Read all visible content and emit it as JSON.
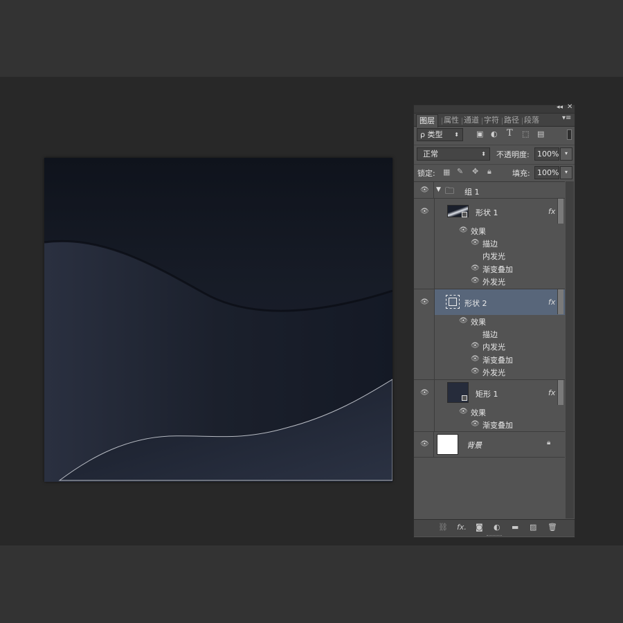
{
  "colors": {
    "canvas_top": "#141822",
    "canvas_mid": "#1a1f2b",
    "canvas_wave": "#262b39",
    "selected_row": "#58667a",
    "panel_bg": "#535353"
  },
  "panel": {
    "tabs": [
      "图层",
      "属性",
      "通道",
      "字符",
      "路径",
      "段落"
    ],
    "filter": {
      "label": "ρ 类型"
    },
    "blend_mode": "正常",
    "opacity": {
      "label": "不透明度:",
      "value": "100%"
    },
    "lock": {
      "label": "锁定:"
    },
    "fill": {
      "label": "填充:",
      "value": "100%"
    },
    "fx_label": "fx"
  },
  "layers": {
    "group": {
      "name": "组 1"
    },
    "shape1": {
      "name": "形状 1",
      "effects_label": "效果",
      "effects": [
        "描边",
        "内发光",
        "渐变叠加",
        "外发光"
      ]
    },
    "shape2": {
      "name": "形状 2",
      "effects_label": "效果",
      "effects": [
        "描边",
        "内发光",
        "渐变叠加",
        "外发光"
      ]
    },
    "rect1": {
      "name": "矩形 1",
      "effects_label": "效果",
      "effects": [
        "渐变叠加"
      ]
    },
    "background": {
      "name": "背景"
    }
  },
  "icons": {
    "eye": "eye-icon",
    "lock": "lock-icon",
    "folder": "folder-icon"
  }
}
